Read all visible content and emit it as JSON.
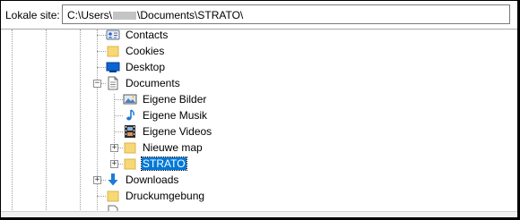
{
  "site_bar": {
    "label": "Lokale site:",
    "path_prefix": "C:\\Users\\",
    "path_suffix": "\\Documents\\STRATO\\"
  },
  "tree": {
    "contacts": "Contacts",
    "cookies": "Cookies",
    "desktop": "Desktop",
    "documents": "Documents",
    "eigene_bilder": "Eigene Bilder",
    "eigene_musik": "Eigene Musik",
    "eigene_videos": "Eigene Videos",
    "nieuwe_map": "Nieuwe map",
    "strato": "STRATO",
    "downloads": "Downloads",
    "druckumgebung": "Druckumgebung"
  },
  "colors": {
    "selection": "#0078d7",
    "folder": "#f8d775",
    "desktop_blue": "#0a64d6",
    "downloads_arrow": "#1e7bd9"
  },
  "expander_symbols": {
    "collapse": "−",
    "expand": "+"
  }
}
